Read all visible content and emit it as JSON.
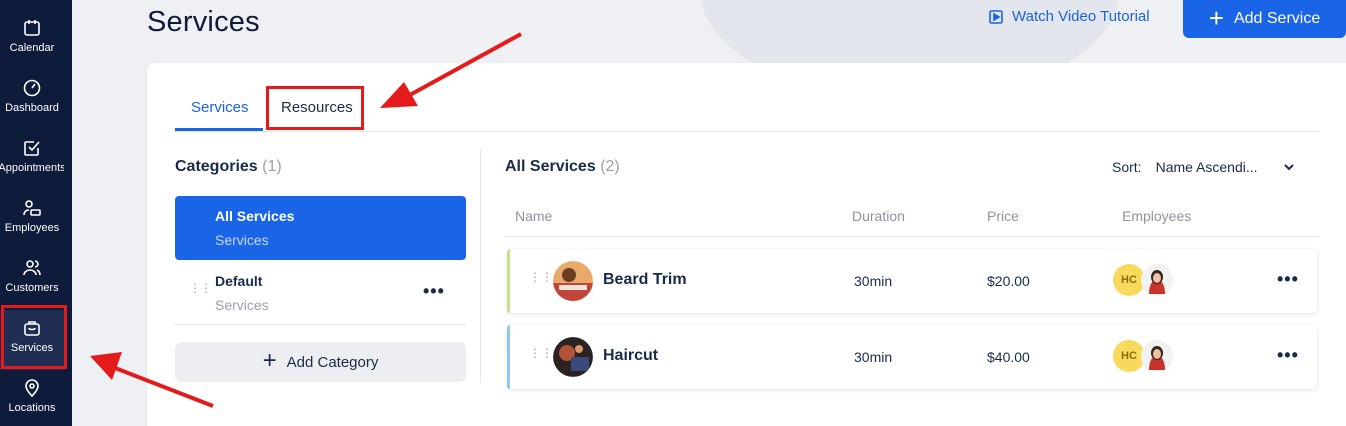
{
  "sidebar": {
    "items": [
      {
        "label": "Calendar",
        "icon": "calendar-icon"
      },
      {
        "label": "Dashboard",
        "icon": "gauge-icon"
      },
      {
        "label": "Appointments",
        "icon": "checkbox-icon"
      },
      {
        "label": "Employees",
        "icon": "employee-icon"
      },
      {
        "label": "Customers",
        "icon": "users-icon"
      },
      {
        "label": "Services",
        "icon": "bag-icon",
        "active": true
      },
      {
        "label": "Locations",
        "icon": "map-pin-icon"
      }
    ]
  },
  "header": {
    "title": "Services",
    "watch_tutorial": "Watch Video Tutorial",
    "add_service": "Add Service"
  },
  "tabs": [
    {
      "label": "Services",
      "active": true
    },
    {
      "label": "Resources",
      "active": false
    }
  ],
  "categories": {
    "title": "Categories",
    "count": "(1)",
    "items": [
      {
        "name": "All Services",
        "sub": "Services",
        "active": true
      },
      {
        "name": "Default",
        "sub": "Services",
        "active": false
      }
    ],
    "add_label": "Add Category"
  },
  "services": {
    "title": "All Services",
    "count": "(2)",
    "sort_label": "Sort:",
    "sort_value": "Name Ascendi...",
    "columns": [
      "Name",
      "Duration",
      "Price",
      "Employees"
    ],
    "rows": [
      {
        "name": "Beard Trim",
        "duration": "30min",
        "price": "$20.00",
        "employee_initials": "HC",
        "accent": "#c7e08a"
      },
      {
        "name": "Haircut",
        "duration": "30min",
        "price": "$40.00",
        "employee_initials": "HC",
        "accent": "#8ec9ec"
      }
    ]
  },
  "colors": {
    "sidebar_bg": "#0e1b3a",
    "accent_blue": "#1a64e8",
    "highlight_red": "#e31b1b"
  }
}
